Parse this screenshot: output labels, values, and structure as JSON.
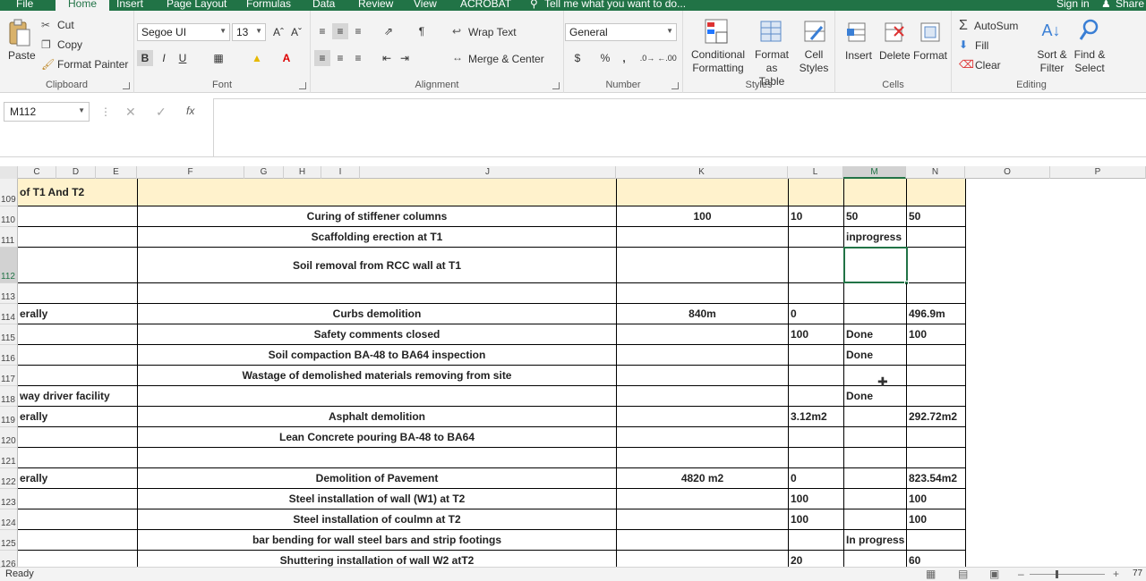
{
  "menu": {
    "tabs": [
      "File",
      "Home",
      "Insert",
      "Page Layout",
      "Formulas",
      "Data",
      "Review",
      "View",
      "ACROBAT"
    ],
    "tell_me": "Tell me what you want to do...",
    "sign_in": "Sign in",
    "share": "Share"
  },
  "ribbon": {
    "clipboard": {
      "paste": "Paste",
      "cut": "Cut",
      "copy": "Copy",
      "format_painter": "Format Painter",
      "group": "Clipboard"
    },
    "font": {
      "name": "Segoe UI",
      "size": "13",
      "bold": "B",
      "italic": "I",
      "underline": "U",
      "group": "Font"
    },
    "alignment": {
      "wrap_text": "Wrap Text",
      "merge_center": "Merge & Center",
      "group": "Alignment"
    },
    "number": {
      "format": "General",
      "currency": "$",
      "percent": "%",
      "comma": ",",
      "group": "Number"
    },
    "styles": {
      "conditional_1": "Conditional",
      "conditional_2": "Formatting",
      "format_as_1": "Format as",
      "format_as_2": "Table",
      "cell_styles_1": "Cell",
      "cell_styles_2": "Styles",
      "group": "Styles"
    },
    "cells": {
      "insert": "Insert",
      "delete": "Delete",
      "format": "Format",
      "group": "Cells"
    },
    "editing": {
      "autosum": "AutoSum",
      "fill": "Fill",
      "clear": "Clear",
      "sort_1": "Sort &",
      "sort_2": "Filter",
      "find_1": "Find &",
      "find_2": "Select",
      "group": "Editing"
    }
  },
  "formula_bar": {
    "name_box": "M112",
    "fx": "fx",
    "content": ""
  },
  "columns": [
    "C",
    "D",
    "E",
    "F",
    "G",
    "H",
    "I",
    "J",
    "K",
    "L",
    "M",
    "N",
    "O",
    "P"
  ],
  "selected_column": "M",
  "rows": [
    {
      "num": "109",
      "c": "of T1 And T2",
      "j": "",
      "k": "",
      "l": "",
      "m": "",
      "n": ""
    },
    {
      "num": "110",
      "c": "",
      "j": "Curing of stiffener columns",
      "k": "100",
      "l": "10",
      "m": "50",
      "n": "50"
    },
    {
      "num": "111",
      "c": "",
      "j": "Scaffolding erection at T1",
      "k": "",
      "l": "",
      "m": "inprogress",
      "n": ""
    },
    {
      "num": "112",
      "c": "",
      "j": "Soil removal from RCC wall at T1",
      "k": "",
      "l": "",
      "m": "",
      "n": ""
    },
    {
      "num": "113",
      "c": "",
      "j": "",
      "k": "",
      "l": "",
      "m": "",
      "n": ""
    },
    {
      "num": "114",
      "c": "erally",
      "j": "Curbs demolition",
      "k": "840m",
      "l": "0",
      "m": "",
      "n": "496.9m"
    },
    {
      "num": "115",
      "c": "",
      "j": "Safety comments closed",
      "k": "",
      "l": "100",
      "m": "Done",
      "n": "100"
    },
    {
      "num": "116",
      "c": "",
      "j": "Soil compaction BA-48 to BA64 inspection",
      "k": "",
      "l": "",
      "m": "Done",
      "n": ""
    },
    {
      "num": "117",
      "c": "",
      "j": "Wastage of  demolished materials removing from site",
      "k": "",
      "l": "",
      "m": "",
      "n": ""
    },
    {
      "num": "118",
      "c": "way driver facility",
      "j": "",
      "k": "",
      "l": "",
      "m": "Done",
      "n": ""
    },
    {
      "num": "119",
      "c": "erally",
      "j": "Asphalt demolition",
      "k": "",
      "l": "3.12m2",
      "m": "",
      "n": "292.72m2"
    },
    {
      "num": "120",
      "c": "",
      "j": "Lean Concrete pouring BA-48 to BA64",
      "k": "",
      "l": "",
      "m": "",
      "n": ""
    },
    {
      "num": "121",
      "c": "",
      "j": "",
      "k": "",
      "l": "",
      "m": "",
      "n": ""
    },
    {
      "num": "122",
      "c": "erally",
      "j": "Demolition of Pavement",
      "k": "4820 m2",
      "l": "0",
      "m": "",
      "n": "823.54m2"
    },
    {
      "num": "123",
      "c": "",
      "j": "Steel installation of wall (W1) at T2",
      "k": "",
      "l": "100",
      "m": "",
      "n": "100"
    },
    {
      "num": "124",
      "c": "",
      "j": "Steel installation of coulmn at T2",
      "k": "",
      "l": "100",
      "m": "",
      "n": "100"
    },
    {
      "num": "125",
      "c": "",
      "j": "bar bending for wall steel bars and strip footings",
      "k": "",
      "l": "",
      "m": "In progress",
      "n": ""
    },
    {
      "num": "126",
      "c": "",
      "j": "Shuttering installation of wall W2 atT2",
      "k": "",
      "l": "20",
      "m": "",
      "n": "60"
    }
  ],
  "status": {
    "ready": "Ready",
    "zoom": "77"
  }
}
